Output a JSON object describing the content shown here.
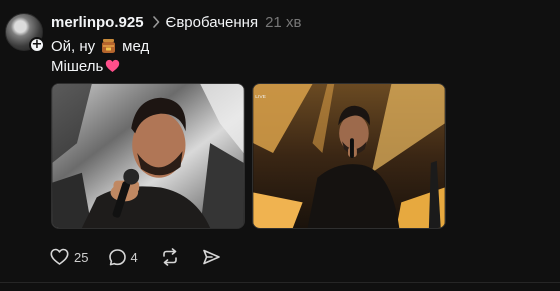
{
  "post": {
    "username": "merlinpo.925",
    "topic": "Євробачення",
    "time": "21 хв",
    "text_line1_before": "Ой, ну",
    "text_line1_after": "мед",
    "text_line2": "Мішель",
    "icons": {
      "follow": "plus-icon",
      "topic": "chevron-right-icon",
      "line1_emoji": "honey-pot-emoji",
      "line2_emoji": "pink-heart-emoji"
    }
  },
  "media": [
    {
      "name": "performer-closeup-photo"
    },
    {
      "name": "performer-stage-photo"
    }
  ],
  "actions": {
    "likes": "25",
    "replies": "4",
    "repost_icon": "repost-icon",
    "share_icon": "send-icon"
  },
  "colors": {
    "background": "#101010",
    "text": "#f3f5f7",
    "muted": "#777777",
    "heart": "#ff4f8b"
  }
}
